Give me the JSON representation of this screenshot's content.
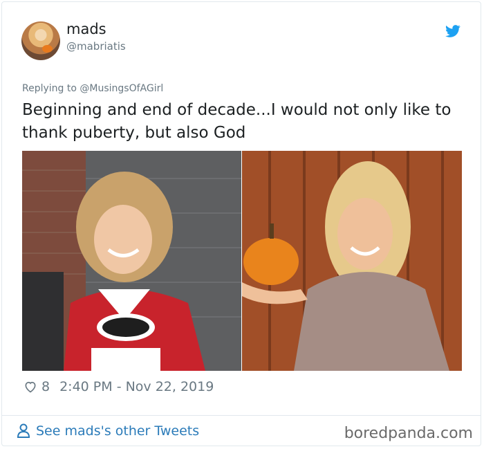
{
  "tweet": {
    "author_name": "mads",
    "author_handle": "@mabriatis",
    "replying_to_prefix": "Replying to",
    "replying_to_handle": "@MusingsOfAGirl",
    "text": "Beginning and end of decade...I would not only like to thank puberty, but also God",
    "likes": "8",
    "timestamp": "2:40 PM - Nov 22, 2019",
    "images": [
      {
        "label": "girl-red-racing-jersey"
      },
      {
        "label": "woman-holding-pumpkin"
      }
    ]
  },
  "footer": {
    "see_more": "See mads's other Tweets",
    "brand": "boredpanda.com"
  },
  "colors": {
    "link": "#2b7bb9",
    "twitter_blue": "#1da1f2",
    "meta_gray": "#697882",
    "border": "#e1e8ed"
  },
  "icons": [
    "twitter-bird-icon",
    "heart-icon",
    "user-icon"
  ]
}
